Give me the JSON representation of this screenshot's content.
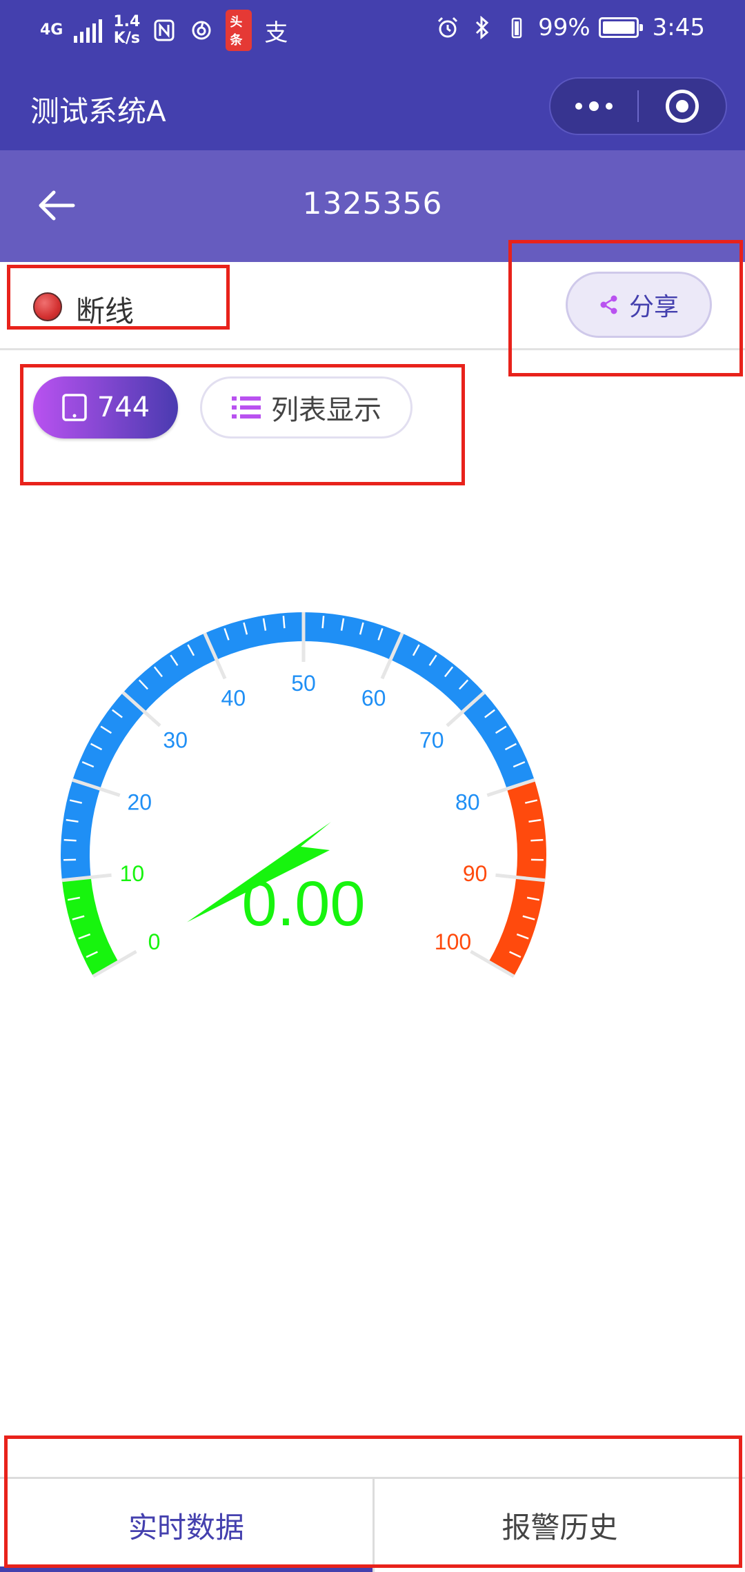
{
  "status_bar": {
    "network_type": "4G",
    "net_speed": "1.4",
    "net_speed_unit": "K/s",
    "toutiao_label": "头条",
    "alipay_glyph": "支",
    "battery_pct": "99%",
    "time": "3:45"
  },
  "mini_program": {
    "title": "测试系统A"
  },
  "nav": {
    "title": "1325356"
  },
  "device_status": {
    "text": "断线"
  },
  "share": {
    "label": "分享"
  },
  "chips": {
    "device_count": "744",
    "list_label": "列表显示"
  },
  "gauge": {
    "min": 0,
    "max": 100,
    "major_labels": [
      "0",
      "10",
      "20",
      "30",
      "40",
      "50",
      "60",
      "70",
      "80",
      "90",
      "100"
    ],
    "value": 0,
    "display_value": "0.00",
    "bands": [
      {
        "from": 0,
        "to": 10,
        "color": "#17f40e"
      },
      {
        "from": 10,
        "to": 80,
        "color": "#1f8ff5"
      },
      {
        "from": 80,
        "to": 100,
        "color": "#ff4a0d"
      }
    ],
    "needle_color": "#17f40e"
  },
  "tabs": [
    {
      "label": "实时数据",
      "active": true
    },
    {
      "label": "报警历史",
      "active": false
    }
  ],
  "colors": {
    "header_dark": "#4440ae",
    "header_light": "#665cbf",
    "annotation_red": "#e8221b"
  }
}
